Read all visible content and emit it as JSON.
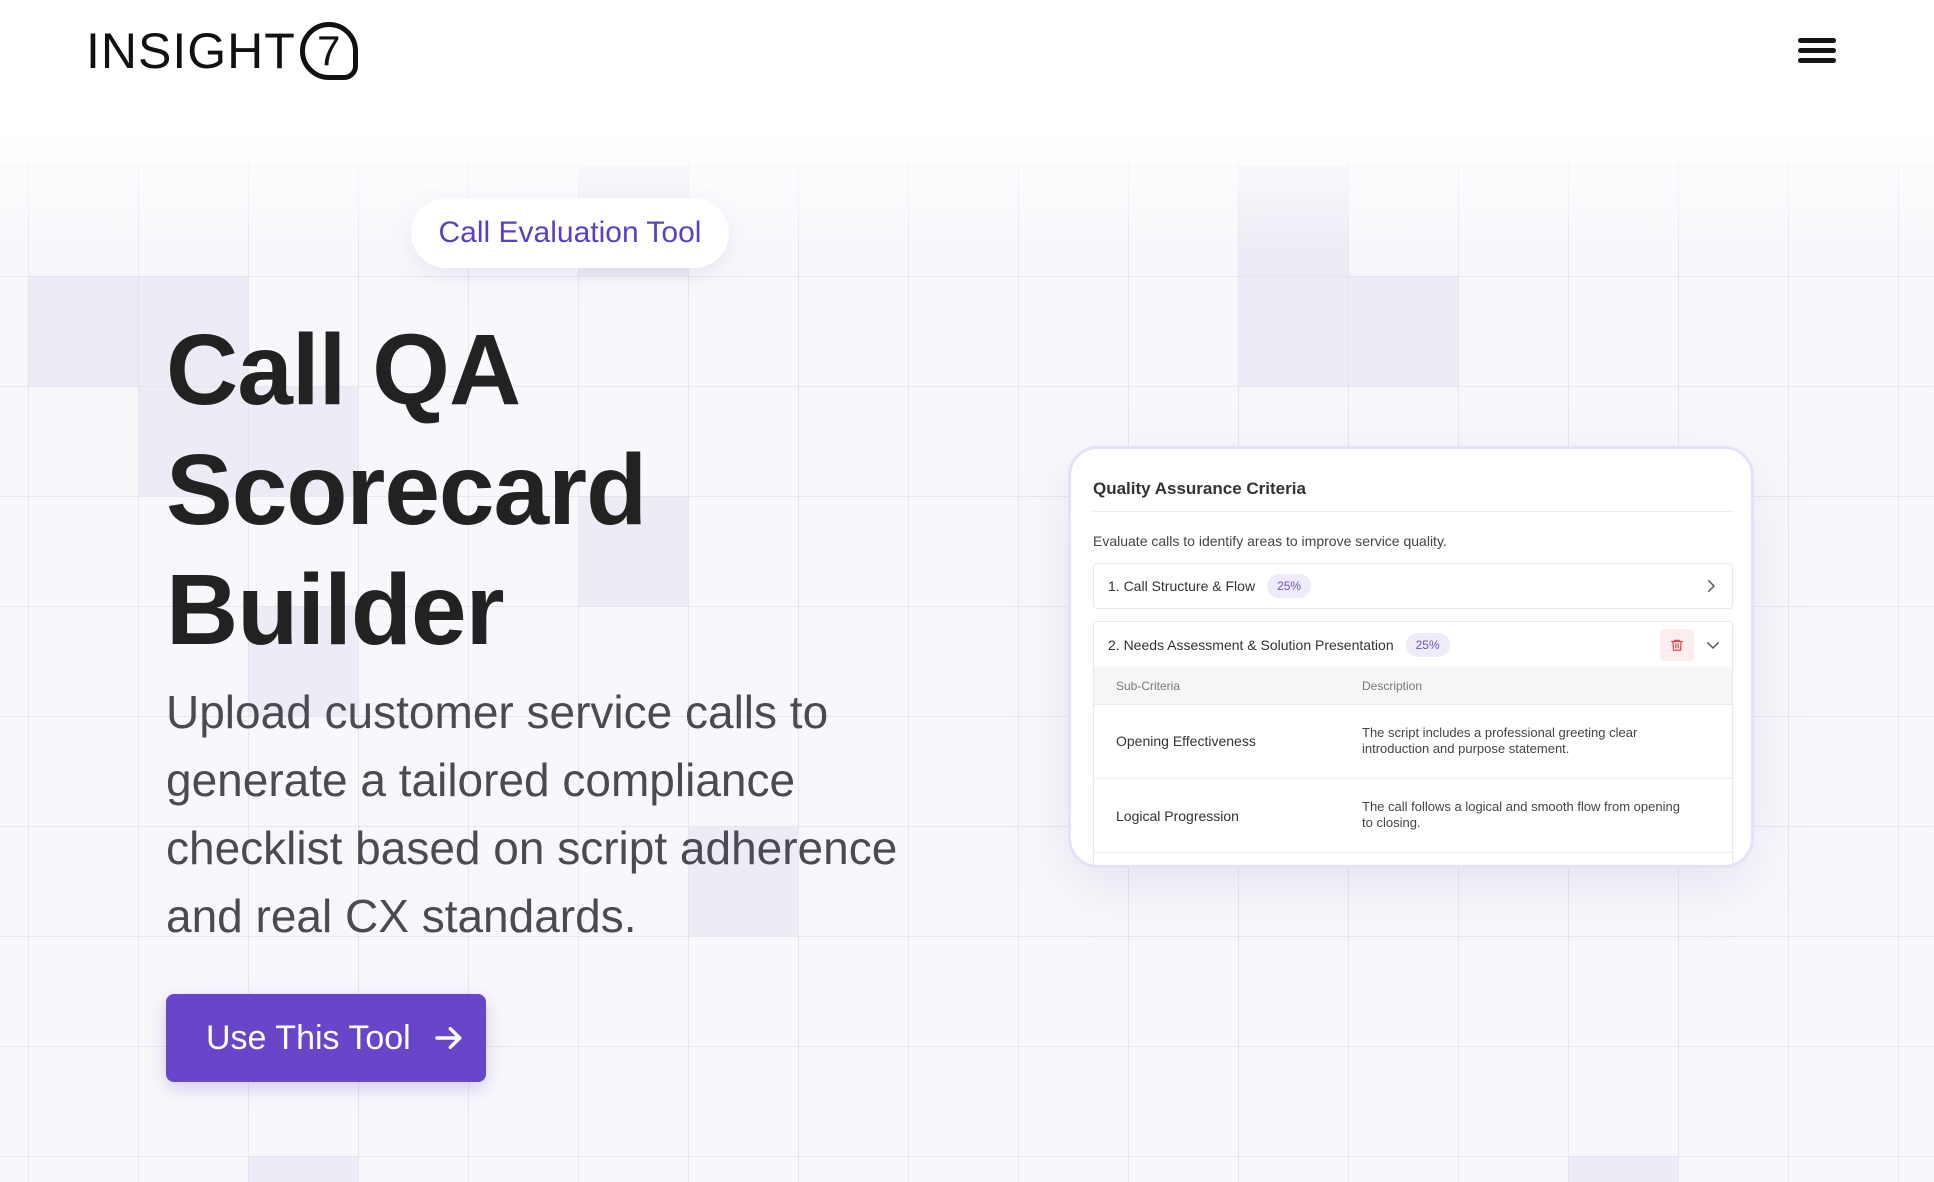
{
  "header": {
    "logo_text": "INSIGHT",
    "logo_mark": "7",
    "menu_icon": "hamburger-menu-icon"
  },
  "hero": {
    "badge": "Call Evaluation Tool",
    "title_lines": [
      "Call QA",
      "Scorecard",
      "Builder"
    ],
    "subtitle": "Upload customer service calls to generate a tailored compliance checklist based on script adherence and real CX standards.",
    "cta_label": "Use This Tool",
    "cta_icon": "arrow-right-icon"
  },
  "card": {
    "title": "Quality Assurance Criteria",
    "description": "Evaluate calls to identify areas to improve service quality.",
    "criteria": [
      {
        "label": "1. Call Structure & Flow",
        "weight": "25%",
        "expanded": false
      },
      {
        "label": "2. Needs Assessment & Solution Presentation",
        "weight": "25%",
        "expanded": true
      }
    ],
    "table": {
      "headers": [
        "Sub-Criteria",
        "Description"
      ],
      "rows": [
        {
          "name": "Opening Effectiveness",
          "description": "The script includes a professional greeting clear introduction and purpose statement."
        },
        {
          "name": "Logical Progression",
          "description": "The call follows a logical and smooth flow from opening to closing."
        }
      ]
    }
  },
  "colors": {
    "accent": "#6945c9",
    "badge_text": "#5b3fc4",
    "delete": "#e5484d"
  }
}
